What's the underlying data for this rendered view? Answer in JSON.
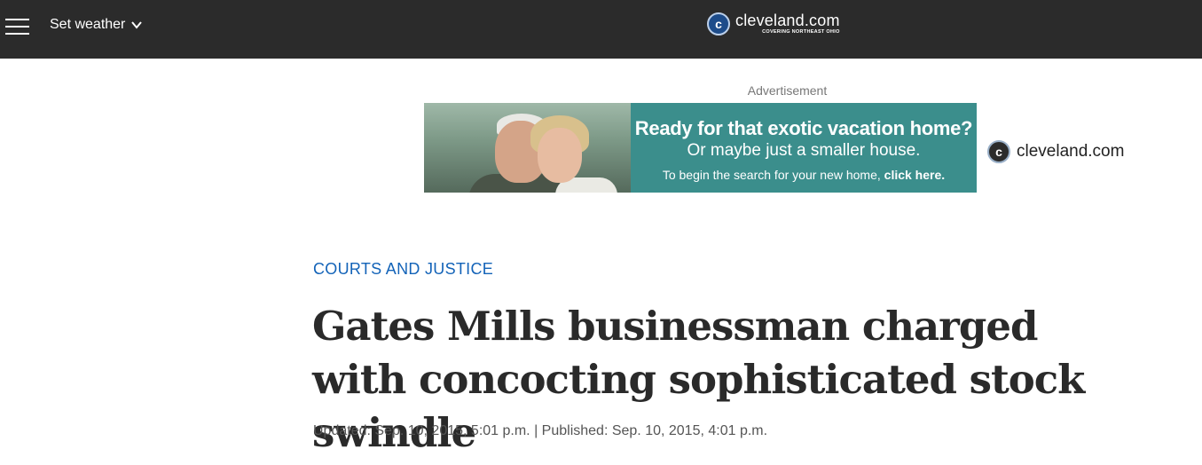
{
  "header": {
    "weather_label": "Set weather",
    "brand": {
      "name": "cleveland.com",
      "tagline": "COVERING NORTHEAST OHIO",
      "logo_letter": "c"
    }
  },
  "ad": {
    "label": "Advertisement",
    "line1": "Ready for that exotic vacation home?",
    "line2": "Or maybe just a smaller house.",
    "line3_prefix": "To begin the search for your new home, ",
    "line3_link": "click here.",
    "brand_name": "cleveland.com",
    "brand_logo_letter": "c",
    "panel_color": "#3b8e8c"
  },
  "article": {
    "section": "COURTS AND JUSTICE",
    "headline": "Gates Mills businessman charged with concocting sophisticated stock swindle",
    "dates": "Updated: Sep. 10, 2015, 5:01 p.m. | Published: Sep. 10, 2015, 4:01 p.m."
  },
  "colors": {
    "header_bg": "#2b2b2b",
    "section_link": "#1363b8"
  },
  "icons": {
    "menu": "hamburger-menu-icon",
    "weather_toggle": "chevron-down-icon",
    "logo": "cleveland-logo-icon"
  }
}
